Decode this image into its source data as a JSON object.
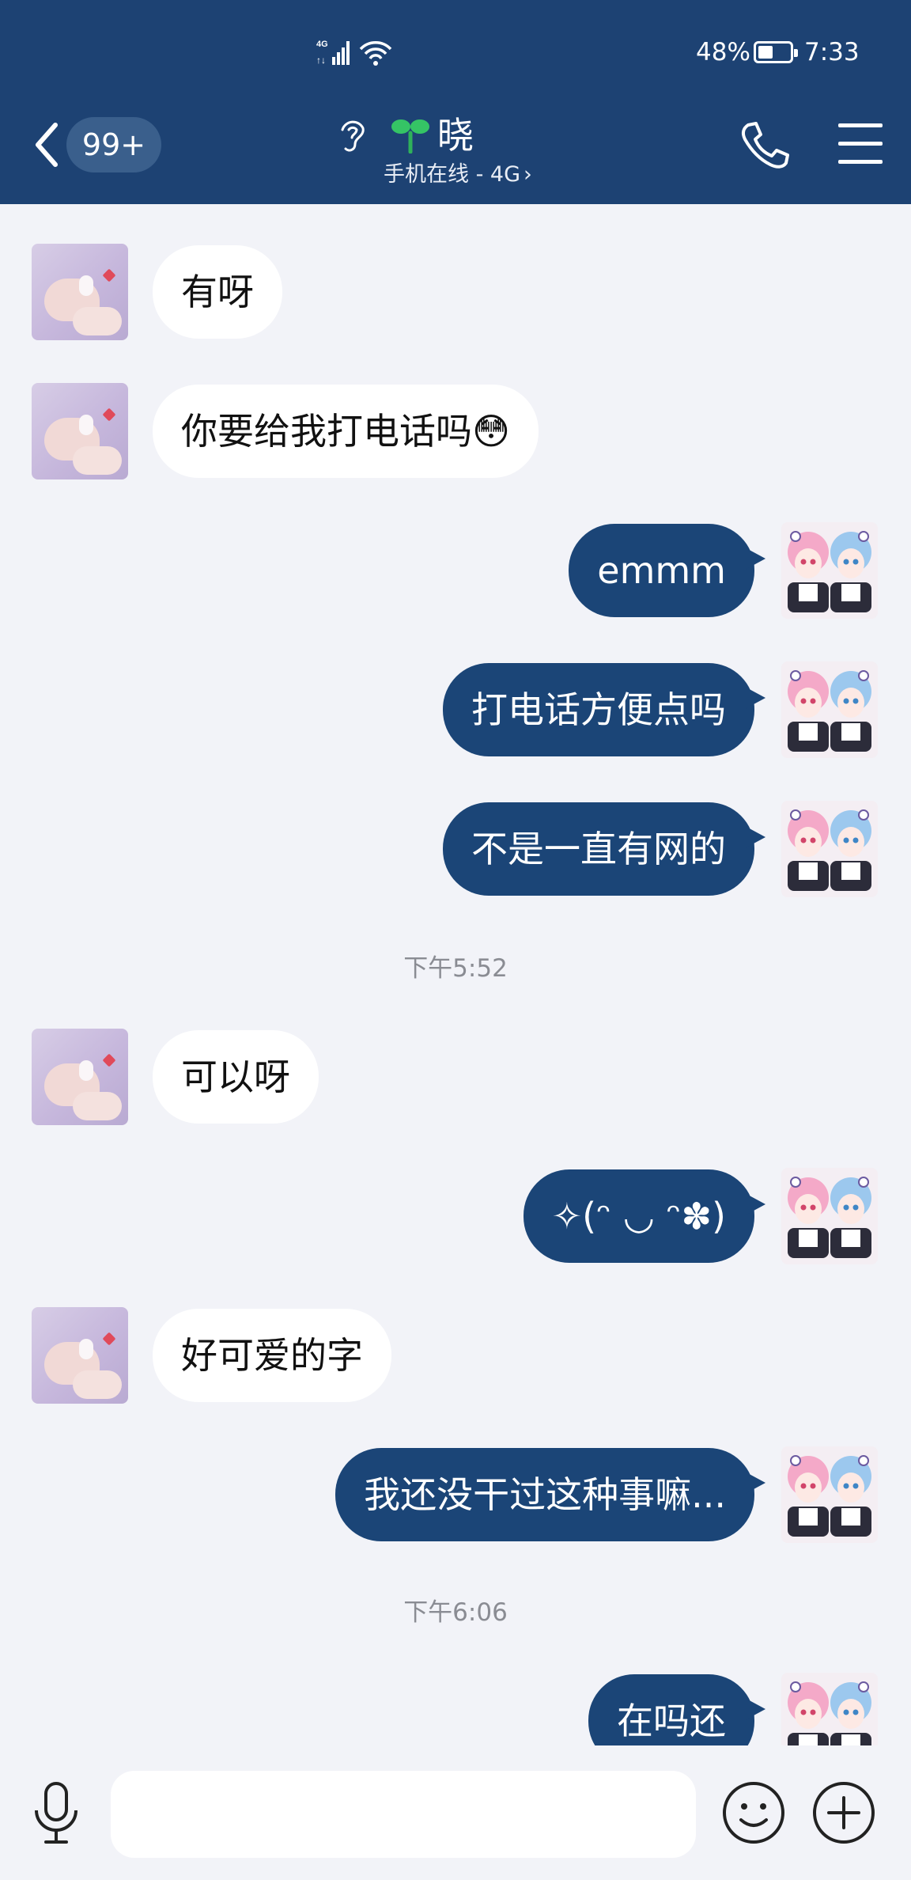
{
  "status_bar": {
    "network_type": "4G",
    "battery_percent": "48%",
    "battery_level": 0.48,
    "time": "7:33"
  },
  "header": {
    "unread_badge": "99+",
    "contact_name": "晓",
    "contact_status": "手机在线 - 4G",
    "icons": [
      "back-icon",
      "ear-icon",
      "sprout-icon",
      "phone-icon",
      "menu-icon"
    ]
  },
  "messages": [
    {
      "side": "left",
      "text": "有呀"
    },
    {
      "side": "left",
      "text": "你要给我打电话吗😳"
    },
    {
      "side": "right",
      "text": "emmm"
    },
    {
      "side": "right",
      "text": "打电话方便点吗"
    },
    {
      "side": "right",
      "text": "不是一直有网的"
    },
    {
      "timestamp": "下午5:52"
    },
    {
      "side": "left",
      "text": "可以呀"
    },
    {
      "side": "right",
      "text": "✧(ᵔ ◡ ᵔ✽)"
    },
    {
      "side": "left",
      "text": "好可爱的字"
    },
    {
      "side": "right",
      "text": "我还没干过这种事嘛..."
    },
    {
      "timestamp": "下午6:06"
    },
    {
      "side": "right",
      "text": "在吗还"
    }
  ],
  "input_bar": {
    "placeholder": "",
    "icons": [
      "microphone-icon",
      "smiley-icon",
      "plus-icon"
    ]
  },
  "colors": {
    "header_bg": "#1d4273",
    "sent_bubble": "#1b4577",
    "received_bubble": "#ffffff",
    "chat_bg": "#f2f3f8"
  }
}
